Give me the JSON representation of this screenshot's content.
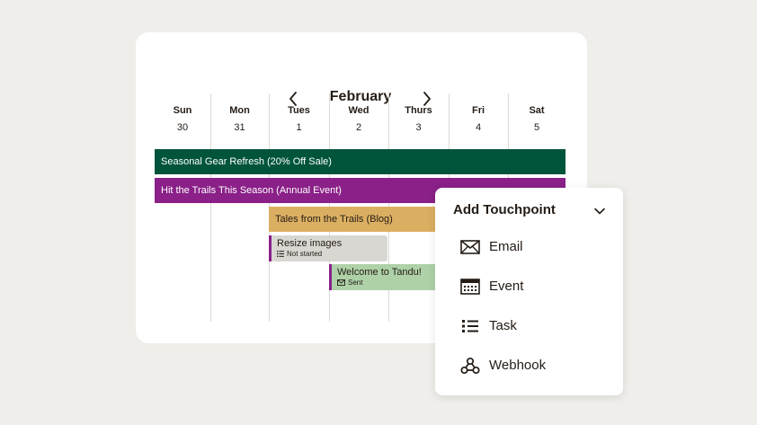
{
  "calendar": {
    "month": "February",
    "days": [
      {
        "name": "Sun",
        "date": "30"
      },
      {
        "name": "Mon",
        "date": "31"
      },
      {
        "name": "Tues",
        "date": "1"
      },
      {
        "name": "Wed",
        "date": "2"
      },
      {
        "name": "Thurs",
        "date": "3"
      },
      {
        "name": "Fri",
        "date": "4"
      },
      {
        "name": "Sat",
        "date": "5"
      }
    ],
    "events": [
      {
        "label": "Seasonal Gear Refresh (20% Off Sale)",
        "color": "#00543c"
      },
      {
        "label": "Hit the Trails This Season (Annual Event)",
        "color": "#8a2088"
      },
      {
        "label": "Tales from the Trails (Blog)",
        "color": "#dbaf62"
      }
    ],
    "tasks": [
      {
        "title": "Resize images",
        "status": "Not started",
        "icon": "list-icon",
        "color": "#d9d7d2"
      },
      {
        "title": "Welcome to Tandu!",
        "status": "Sent",
        "icon": "envelope-icon",
        "color": "#aed1a8"
      }
    ]
  },
  "touchpoint_menu": {
    "title": "Add Touchpoint",
    "items": [
      {
        "label": "Email",
        "icon": "envelope-icon"
      },
      {
        "label": "Event",
        "icon": "calendar-icon"
      },
      {
        "label": "Task",
        "icon": "list-icon"
      },
      {
        "label": "Webhook",
        "icon": "webhook-icon"
      }
    ]
  }
}
